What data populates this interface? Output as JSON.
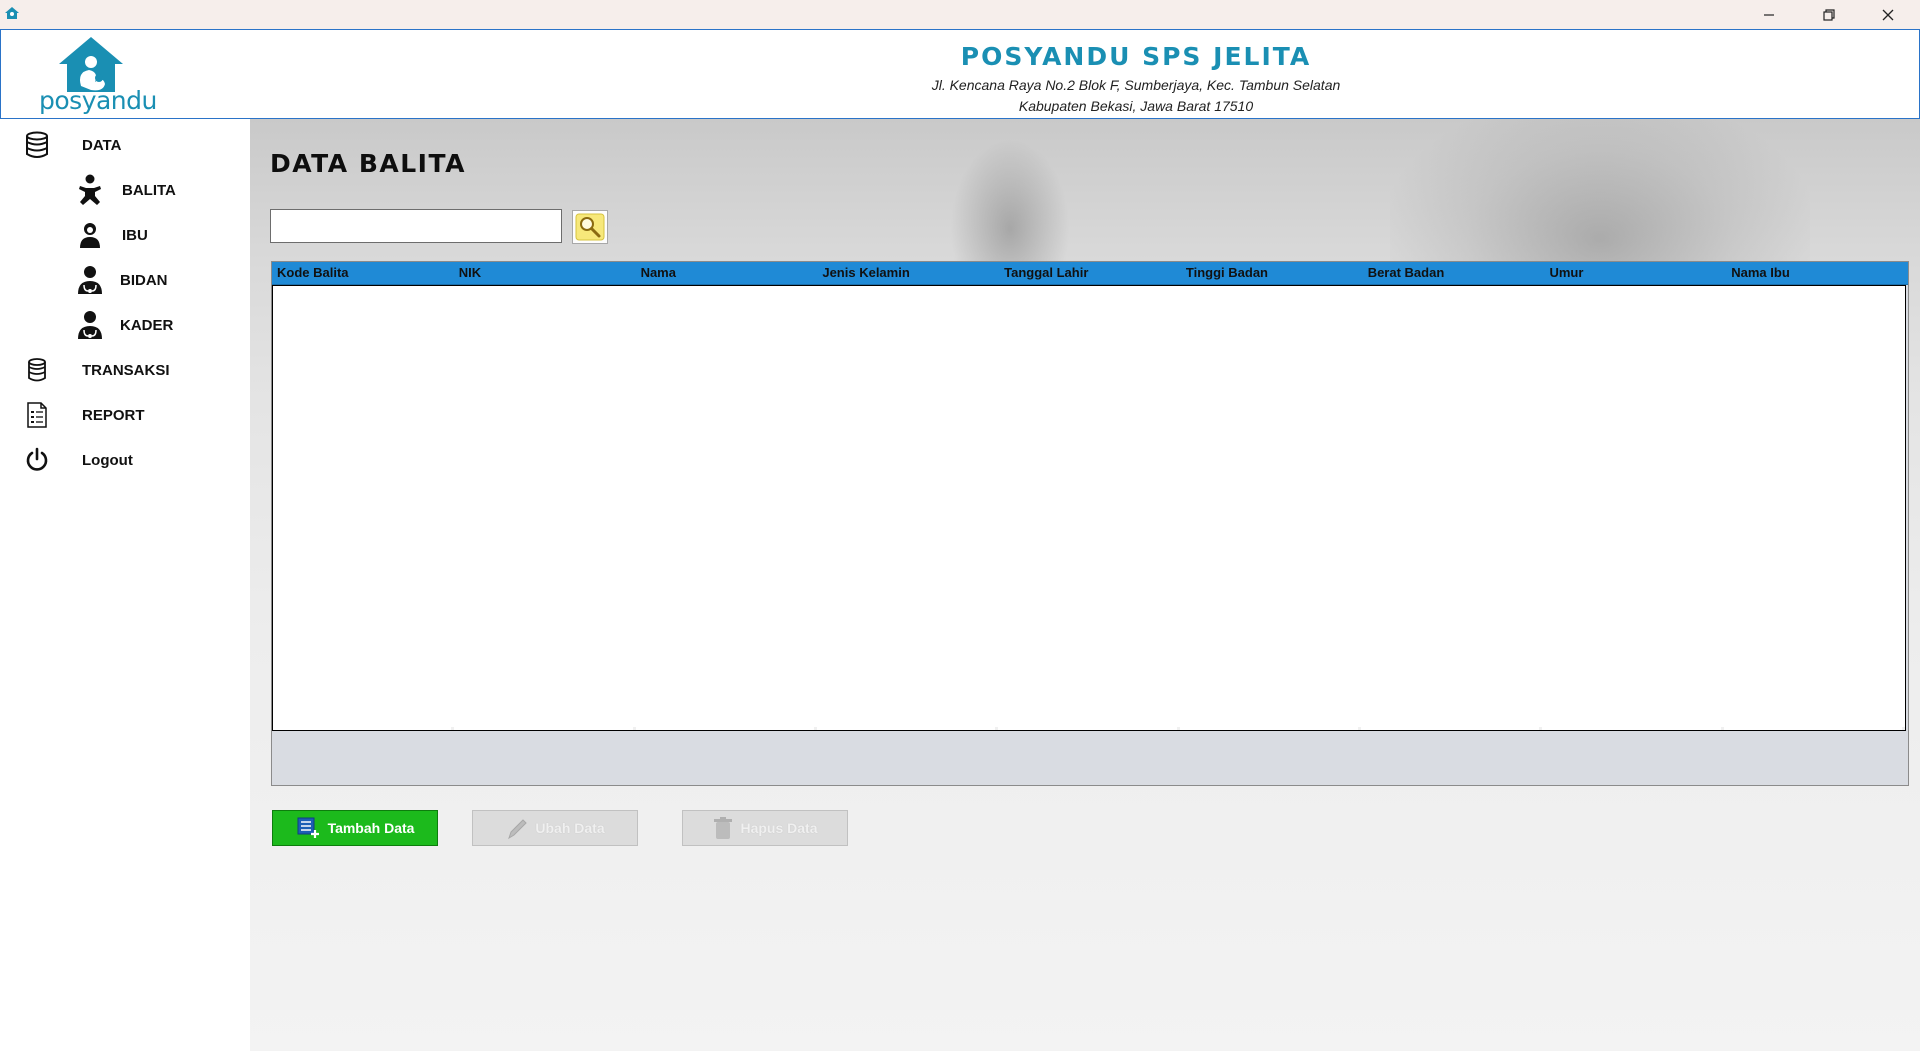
{
  "window": {
    "controls": {
      "minimize_icon": "minimize-icon",
      "maximize_icon": "restore-icon",
      "close_icon": "close-icon"
    }
  },
  "header": {
    "logo_text": "posyandu",
    "org_name": "POSYANDU SPS JELITA",
    "address_line1": "Jl. Kencana Raya No.2 Blok F, Sumberjaya, Kec. Tambun Selatan",
    "address_line2": "Kabupaten Bekasi, Jawa Barat 17510"
  },
  "sidebar": {
    "items": [
      {
        "label": "DATA",
        "icon": "database-icon"
      },
      {
        "label": "BALITA",
        "icon": "baby-icon"
      },
      {
        "label": "IBU",
        "icon": "mother-icon"
      },
      {
        "label": "BIDAN",
        "icon": "midwife-icon"
      },
      {
        "label": "KADER",
        "icon": "cadre-icon"
      },
      {
        "label": "TRANSAKSI",
        "icon": "transaction-icon"
      },
      {
        "label": "REPORT",
        "icon": "report-icon"
      },
      {
        "label": "Logout",
        "icon": "power-icon"
      }
    ]
  },
  "main": {
    "title": "DATA BALITA",
    "search": {
      "value": "",
      "placeholder": ""
    },
    "table": {
      "columns": [
        "Kode Balita",
        "NIK",
        "Nama",
        "Jenis Kelamin",
        "Tanggal Lahir",
        "Tinggi Badan",
        "Berat Badan",
        "Umur",
        "Nama Ibu"
      ],
      "rows": []
    },
    "buttons": {
      "add": "Tambah Data",
      "edit": "Ubah Data",
      "delete": "Hapus Data"
    }
  },
  "colors": {
    "brand": "#1a8fb3",
    "table_header": "#1f8ad6",
    "add_button": "#1cba1c",
    "disabled_button": "#dcdcdc"
  }
}
